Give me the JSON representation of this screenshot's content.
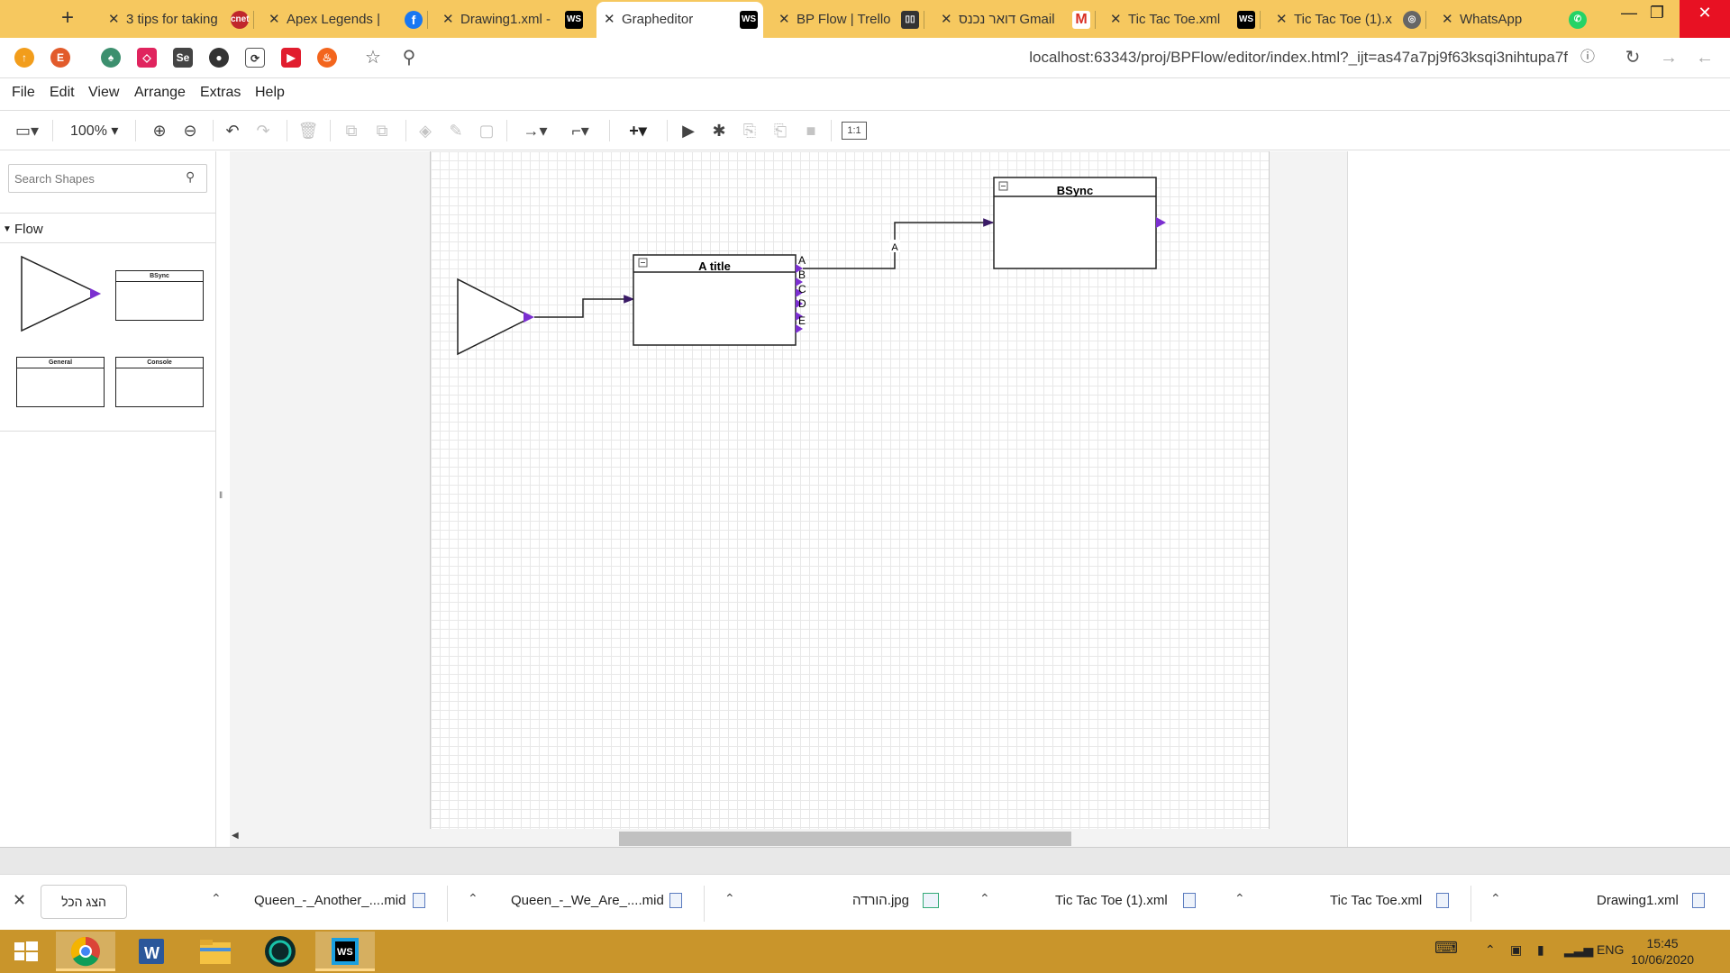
{
  "browser": {
    "tabs": [
      {
        "title": "3 tips for taking",
        "favicon": "cnet",
        "color": "#c0262c",
        "active": false
      },
      {
        "title": "Apex Legends |",
        "favicon": "facebook",
        "color": "#1877f2",
        "active": false
      },
      {
        "title": "Drawing1.xml -",
        "favicon": "webstorm",
        "color": "#000000",
        "active": false
      },
      {
        "title": "Grapheditor",
        "favicon": "webstorm",
        "color": "#000000",
        "active": true
      },
      {
        "title": "BP Flow | Trello",
        "favicon": "trello",
        "color": "#333333",
        "active": false
      },
      {
        "title": "דואר נכנס Gmail",
        "favicon": "gmail",
        "color": "#d93025",
        "active": false
      },
      {
        "title": "Tic Tac Toe.xml",
        "favicon": "webstorm",
        "color": "#000000",
        "active": false
      },
      {
        "title": "Tic Tac Toe (1).x",
        "favicon": "globe",
        "color": "#666666",
        "active": false
      },
      {
        "title": "WhatsApp",
        "favicon": "whatsapp",
        "color": "#25d366",
        "active": false
      }
    ],
    "url": "localhost:63343/proj/BPFlow/editor/index.html?_ijt=as47a7pj9f63ksqi3nihtupa7f"
  },
  "menu": [
    "File",
    "Edit",
    "View",
    "Arrange",
    "Extras",
    "Help"
  ],
  "toolbar": {
    "zoom": "100%"
  },
  "sidebar": {
    "search_placeholder": "Search Shapes",
    "section": "Flow",
    "shapes": [
      {
        "kind": "triangle",
        "label": ""
      },
      {
        "kind": "box",
        "label": "BSync"
      },
      {
        "kind": "box",
        "label": "General"
      },
      {
        "kind": "box",
        "label": "Console"
      }
    ]
  },
  "diagram": {
    "title_node": "A title",
    "bsync_node": "BSync",
    "ports": [
      "A",
      "B",
      "C",
      "D",
      "E"
    ],
    "edge_label": "A"
  },
  "downloads": {
    "show_all": "הצג הכל",
    "items": [
      "Queen_-_Another_....mid",
      "Queen_-_We_Are_....mid",
      "הורדה.jpg",
      "Tic Tac Toe (1).xml",
      "Tic Tac Toe.xml",
      "Drawing1.xml"
    ]
  },
  "taskbar": {
    "lang": "ENG",
    "time": "15:45",
    "date": "10/06/2020"
  },
  "colors": {
    "accent": "#7b2fd0",
    "tabbar": "#f6c85f",
    "taskbar": "#c9952b"
  }
}
